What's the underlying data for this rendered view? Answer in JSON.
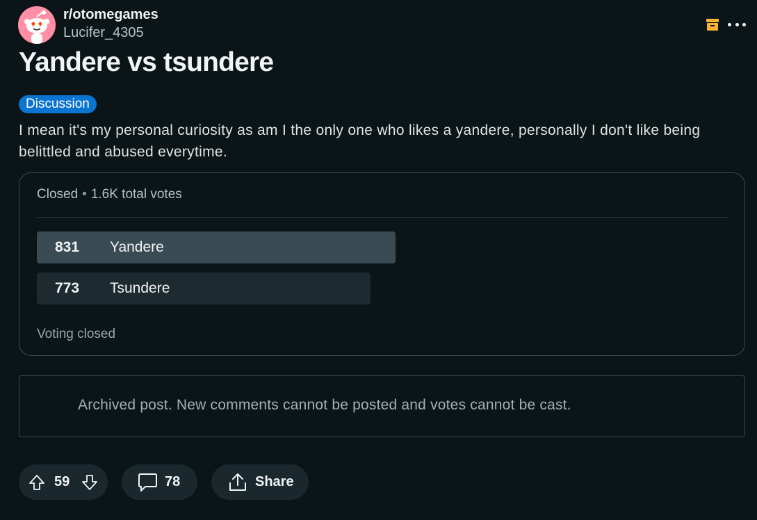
{
  "post": {
    "subreddit": "r/otomegames",
    "author": "Lucifer_4305",
    "title": "Yandere vs tsundere",
    "flair": "Discussion",
    "body": "I mean it's my personal curiosity as am I the only one who likes a yandere, personally I don't like being belittled and abused everytime."
  },
  "header_icons": {
    "archive": "archive-icon",
    "more": "more-options-icon",
    "archive_color": "#f5b433"
  },
  "poll": {
    "status": "Closed",
    "separator": "•",
    "total_votes": "1.6K total votes",
    "options": [
      {
        "count": "831",
        "label": "Yandere",
        "share": 0.518
      },
      {
        "count": "773",
        "label": "Tsundere",
        "share": 0.482
      }
    ],
    "footer": "Voting closed"
  },
  "archived_notice": "Archived post. New comments cannot be posted and votes cannot be cast.",
  "actions": {
    "score": "59",
    "comments": "78",
    "share_label": "Share"
  },
  "colors": {
    "background": "#0b1416",
    "flair": "#0a74d1",
    "winning_option": "#3a4b53",
    "losing_option": "#1d2a30"
  }
}
